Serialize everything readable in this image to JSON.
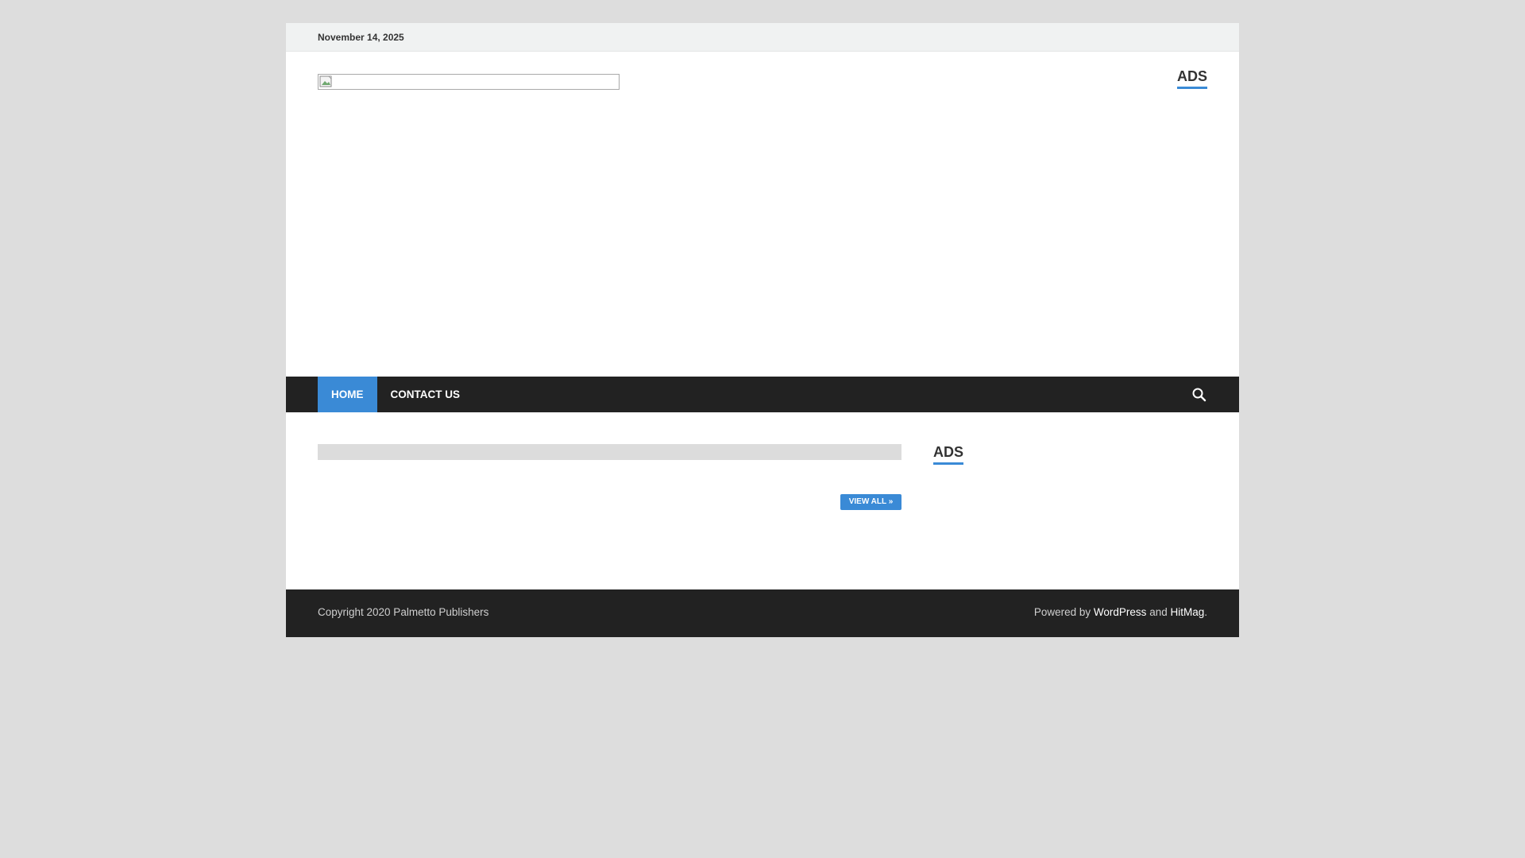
{
  "topbar": {
    "date": "November 14, 2025"
  },
  "header": {
    "ads_label": "ADS"
  },
  "nav": {
    "items": [
      {
        "label": "HOME"
      },
      {
        "label": "CONTACT US"
      }
    ]
  },
  "content": {
    "view_all_label": "VIEW ALL »",
    "sidebar_ads_label": "ADS"
  },
  "footer": {
    "copyright": "Copyright 2020 Palmetto Publishers",
    "powered_prefix": "Powered by ",
    "wordpress_link": "WordPress",
    "and_text": " and ",
    "hitmag_link": "HitMag",
    "period": "."
  },
  "colors": {
    "accent": "#3a8ad6",
    "dark": "#222222",
    "page_bg": "#dddddd"
  },
  "icons": {
    "search": "search-icon",
    "logo": "broken-image-icon"
  }
}
